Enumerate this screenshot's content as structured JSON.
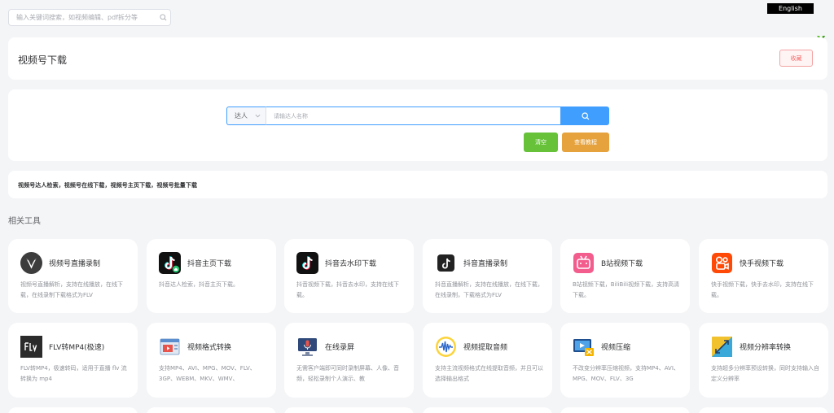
{
  "top_search": {
    "placeholder": "输入关键词搜索，如视频编辑、pdf拆分等"
  },
  "lang_button": "English",
  "page": {
    "title": "视频号下载",
    "favorite_label": "收藏"
  },
  "search": {
    "type_value": "达人",
    "input_placeholder": "请输达人名称",
    "clear_label": "清空",
    "tutorial_label": "查看教程"
  },
  "description": "视频号达人检索，视频号在线下载，视频号主页下载，视频号批量下载",
  "related_title": "相关工具",
  "tools": [
    {
      "name": "视频号直播录制",
      "desc": "视频号直播解析，支持在线播放，在线下载，在线录制下载格式为FLV",
      "icon": "wechat-channels-icon"
    },
    {
      "name": "抖音主页下载",
      "desc": "抖音达人检索，抖音主页下载。",
      "icon": "douyin-home-icon"
    },
    {
      "name": "抖音去水印下载",
      "desc": "抖音视频下载，抖音去水印，支持在线下载。",
      "icon": "douyin-icon"
    },
    {
      "name": "抖音直播录制",
      "desc": "抖音直播解析，支持在线播放，在线下载，在线录制，下载格式为FLV",
      "icon": "douyin-live-icon"
    },
    {
      "name": "B站视频下载",
      "desc": "B站视频下载，BiliBili视频下载，支持高清下载。",
      "icon": "bilibili-icon"
    },
    {
      "name": "快手视频下载",
      "desc": "快手视频下载，快手去水印，支持在线下载。",
      "icon": "kuaishou-icon"
    },
    {
      "name": "FLV转MP4(极速)",
      "desc": "FLV转MP4，极速转码，适用于直播 flv 流转换为 mp4",
      "icon": "flv-icon"
    },
    {
      "name": "视频格式转换",
      "desc": "支持MP4、AVI、MPG、MOV、FLV、3GP、WEBM、MKV、WMV、",
      "icon": "video-format-icon"
    },
    {
      "name": "在线录屏",
      "desc": "无需客户端即可同时录制屏幕、人像、音频，轻松录制个人演示、教",
      "icon": "screen-record-icon"
    },
    {
      "name": "视频提取音频",
      "desc": "支持主流视频格式在线提取音频，并且可以选择输出格式",
      "icon": "audio-extract-icon"
    },
    {
      "name": "视频压缩",
      "desc": "不改变分辨率压缩视频，支持MP4、AVI、MPG、MOV、FLV、3G",
      "icon": "video-compress-icon"
    },
    {
      "name": "视频分辨率转换",
      "desc": "支持超多分辨率预设转换，同时支持输入自定义分辨率",
      "icon": "resolution-icon"
    }
  ]
}
